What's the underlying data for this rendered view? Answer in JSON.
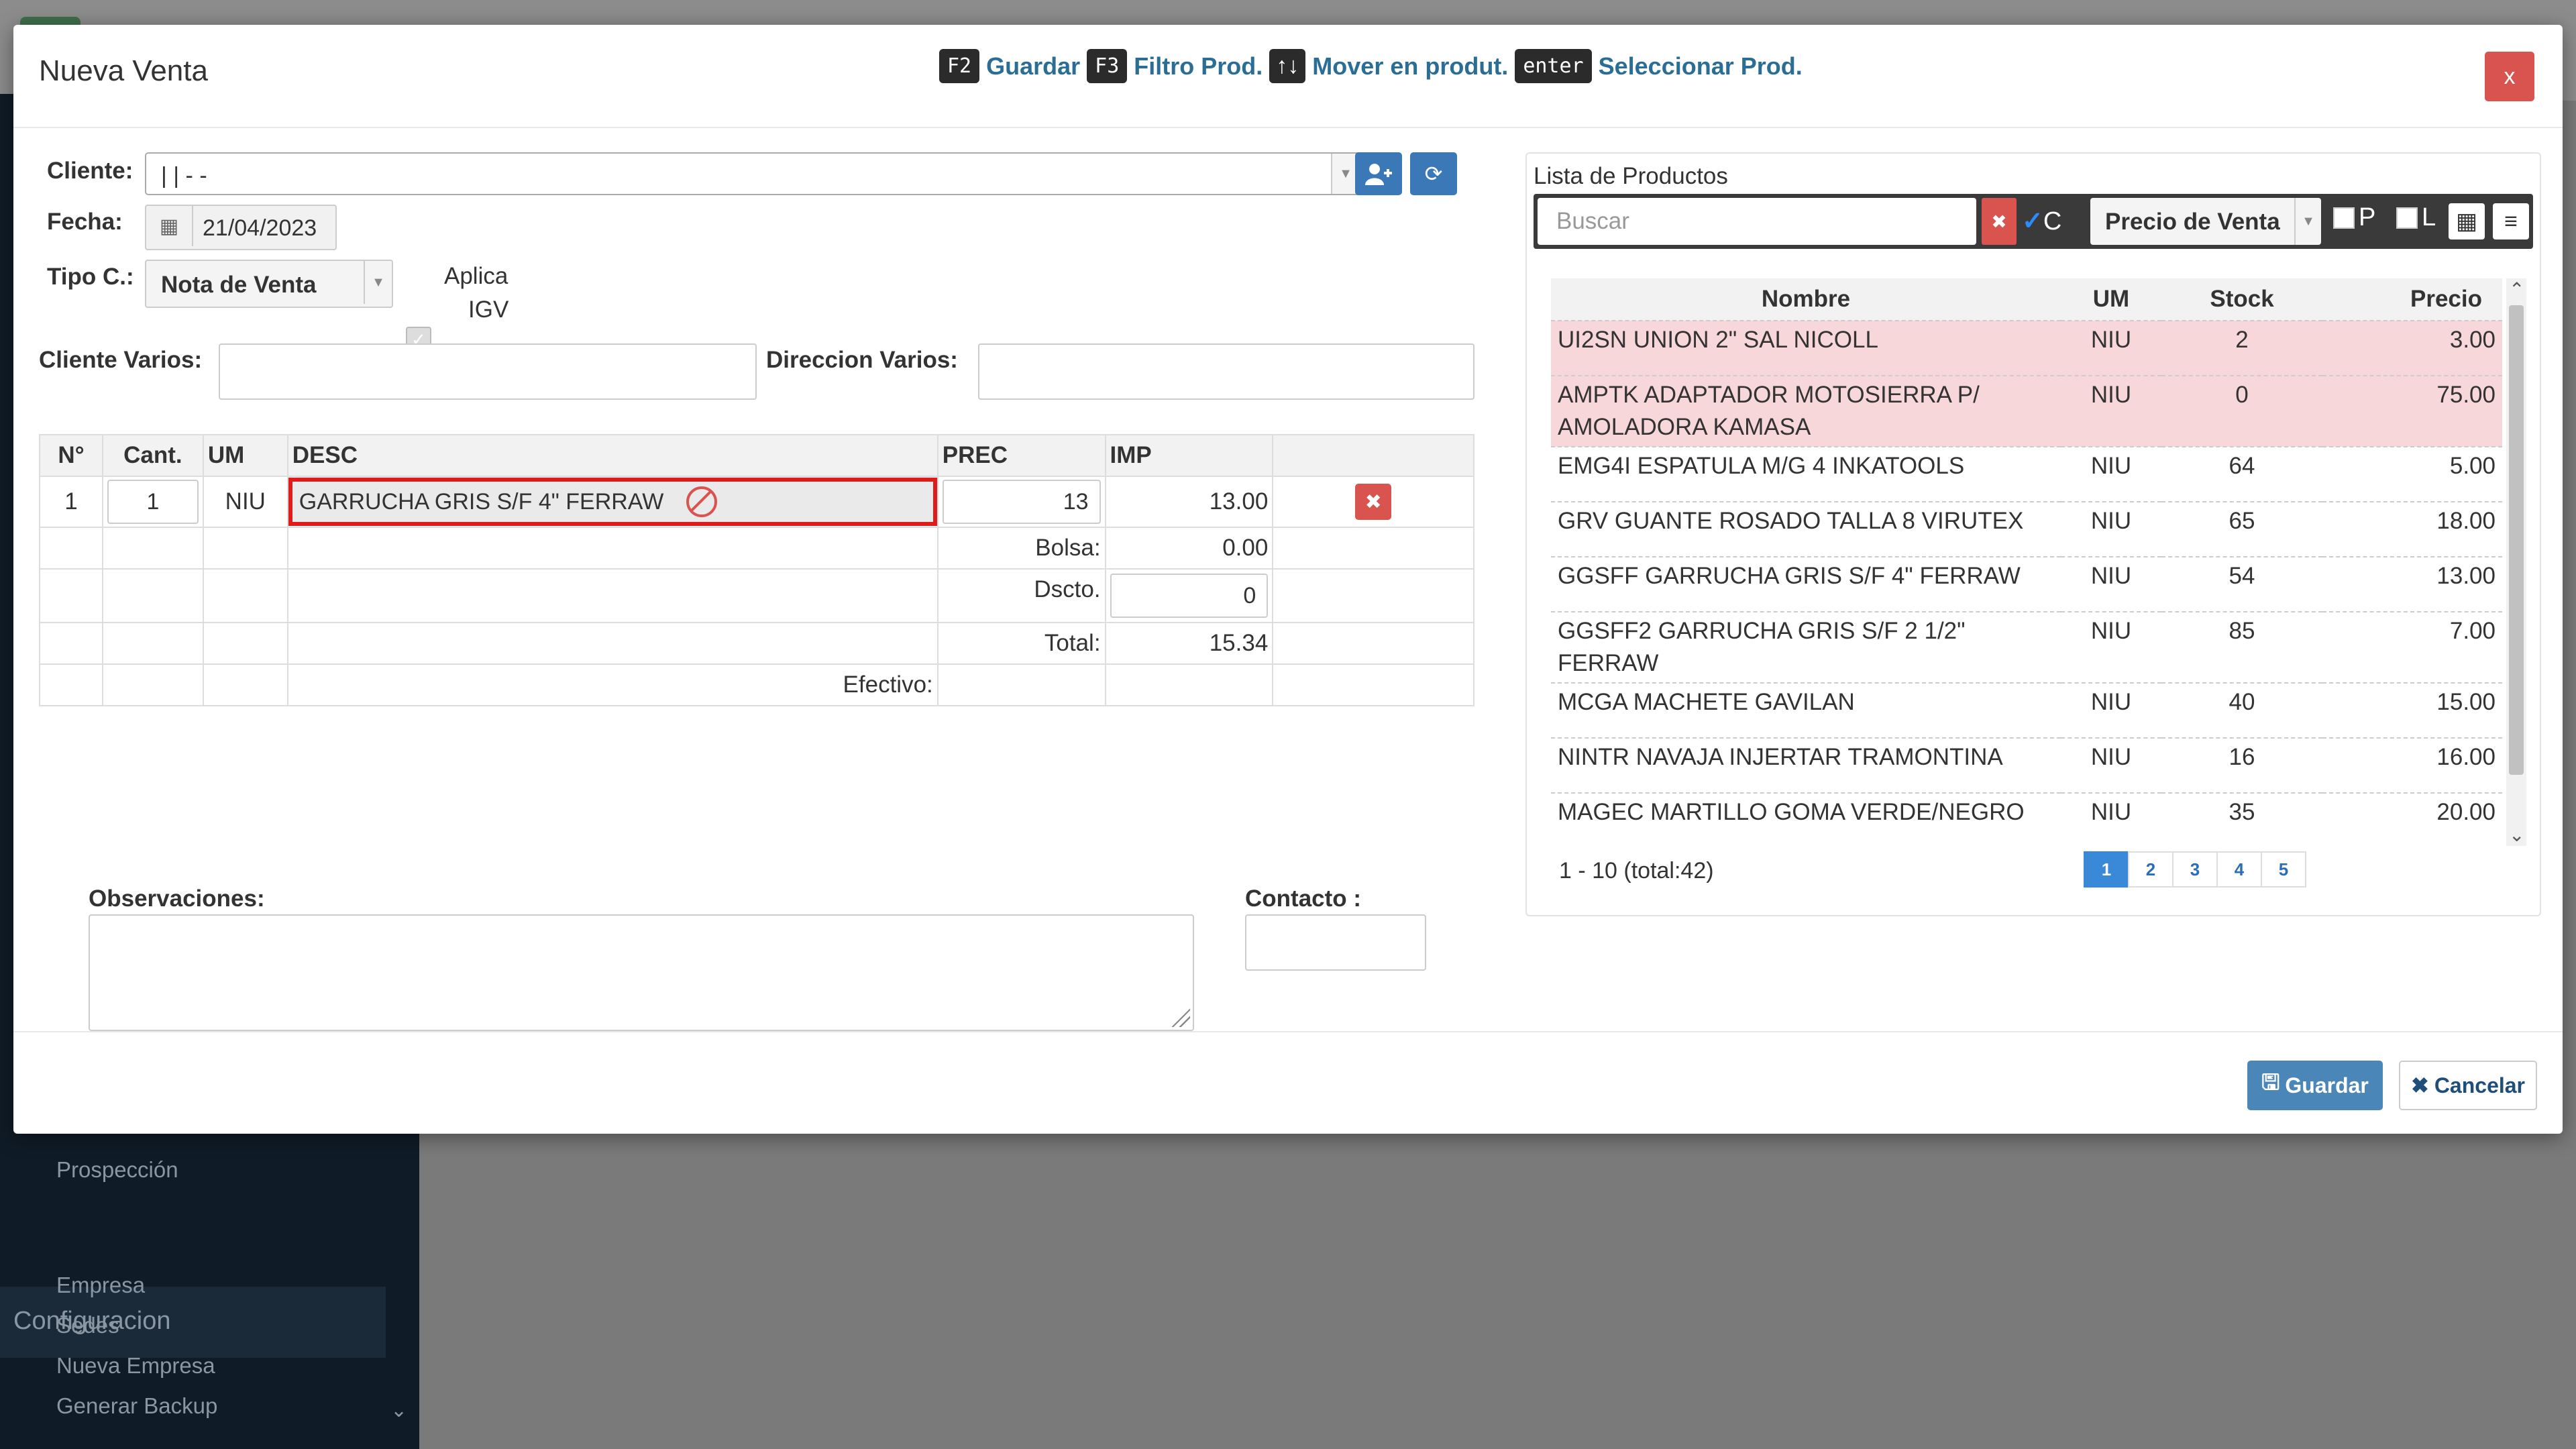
{
  "background": {
    "sidebar_items": [
      "Prospección"
    ],
    "sidebar_section": "Configuracion",
    "sidebar_sub_items": [
      "Empresa",
      "Sedes",
      "Nueva Empresa",
      "Generar Backup"
    ]
  },
  "modal": {
    "title": "Nueva Venta",
    "close_label": "x",
    "shortcuts": [
      {
        "key": "F2",
        "label": "Guardar"
      },
      {
        "key": "F3",
        "label": "Filtro Prod."
      },
      {
        "key": "↑↓",
        "label": "Mover en produt."
      },
      {
        "key": "enter",
        "label": "Seleccionar Prod."
      }
    ]
  },
  "form": {
    "cliente_label": "Cliente:",
    "cliente_value": "| | - -",
    "fecha_label": "Fecha:",
    "fecha_value": "21/04/2023",
    "tipo_label": "Tipo C.:",
    "tipo_value": "Nota de Venta",
    "aplica_label": "Aplica",
    "igv_label": "IGV",
    "cliente_varios_label": "Cliente Varios:",
    "direccion_varios_label": "Direccion Varios:",
    "observaciones_label": "Observaciones:",
    "contacto_label": "Contacto :"
  },
  "items": {
    "headers": [
      "N°",
      "Cant.",
      "UM",
      "DESC",
      "PREC",
      "IMP"
    ],
    "rows": [
      {
        "n": "1",
        "cant": "1",
        "um": "NIU",
        "desc": "GARRUCHA GRIS S/F 4\" FERRAW",
        "prec": "13",
        "imp": "13.00"
      }
    ],
    "bolsa_label": "Bolsa:",
    "bolsa_value": "0.00",
    "dscto_label": "Dscto.",
    "dscto_value": "0",
    "total_label": "Total:",
    "total_value": "15.34",
    "efectivo_label": "Efectivo:"
  },
  "products": {
    "title": "Lista de Productos",
    "search_placeholder": "Buscar",
    "c_label": "C",
    "price_select": "Precio de Venta",
    "p_label": "P",
    "l_label": "L",
    "headers": [
      "Nombre",
      "UM",
      "Stock",
      "Precio"
    ],
    "rows": [
      {
        "nombre": "UI2SN UNION 2\" SAL NICOLL",
        "um": "NIU",
        "stock": "2",
        "precio": "3.00",
        "alert": true
      },
      {
        "nombre": "AMPTK ADAPTADOR MOTOSIERRA P/ AMOLADORA KAMASA",
        "um": "NIU",
        "stock": "0",
        "precio": "75.00",
        "alert": true
      },
      {
        "nombre": "EMG4I ESPATULA M/G 4 INKATOOLS",
        "um": "NIU",
        "stock": "64",
        "precio": "5.00",
        "alert": false
      },
      {
        "nombre": "GRV GUANTE ROSADO TALLA 8 VIRUTEX",
        "um": "NIU",
        "stock": "65",
        "precio": "18.00",
        "alert": false
      },
      {
        "nombre": "GGSFF GARRUCHA GRIS S/F 4\" FERRAW",
        "um": "NIU",
        "stock": "54",
        "precio": "13.00",
        "alert": false
      },
      {
        "nombre": "GGSFF2 GARRUCHA GRIS S/F 2 1/2\" FERRAW",
        "um": "NIU",
        "stock": "85",
        "precio": "7.00",
        "alert": false
      },
      {
        "nombre": "MCGA MACHETE GAVILAN",
        "um": "NIU",
        "stock": "40",
        "precio": "15.00",
        "alert": false
      },
      {
        "nombre": "NINTR NAVAJA INJERTAR TRAMONTINA",
        "um": "NIU",
        "stock": "16",
        "precio": "16.00",
        "alert": false
      },
      {
        "nombre": "MAGEC MARTILLO GOMA VERDE/NEGRO",
        "um": "NIU",
        "stock": "35",
        "precio": "20.00",
        "alert": false
      }
    ],
    "pagination_info": "1 - 10 (total:42)",
    "pages": [
      "1",
      "2",
      "3",
      "4",
      "5"
    ]
  },
  "footer": {
    "save_label": "Guardar",
    "cancel_label": "Cancelar"
  },
  "colors": {
    "primary": "#3a78b8",
    "danger": "#d9534f",
    "alert_row": "#f8d7da",
    "highlight_border": "#e01b1b"
  }
}
